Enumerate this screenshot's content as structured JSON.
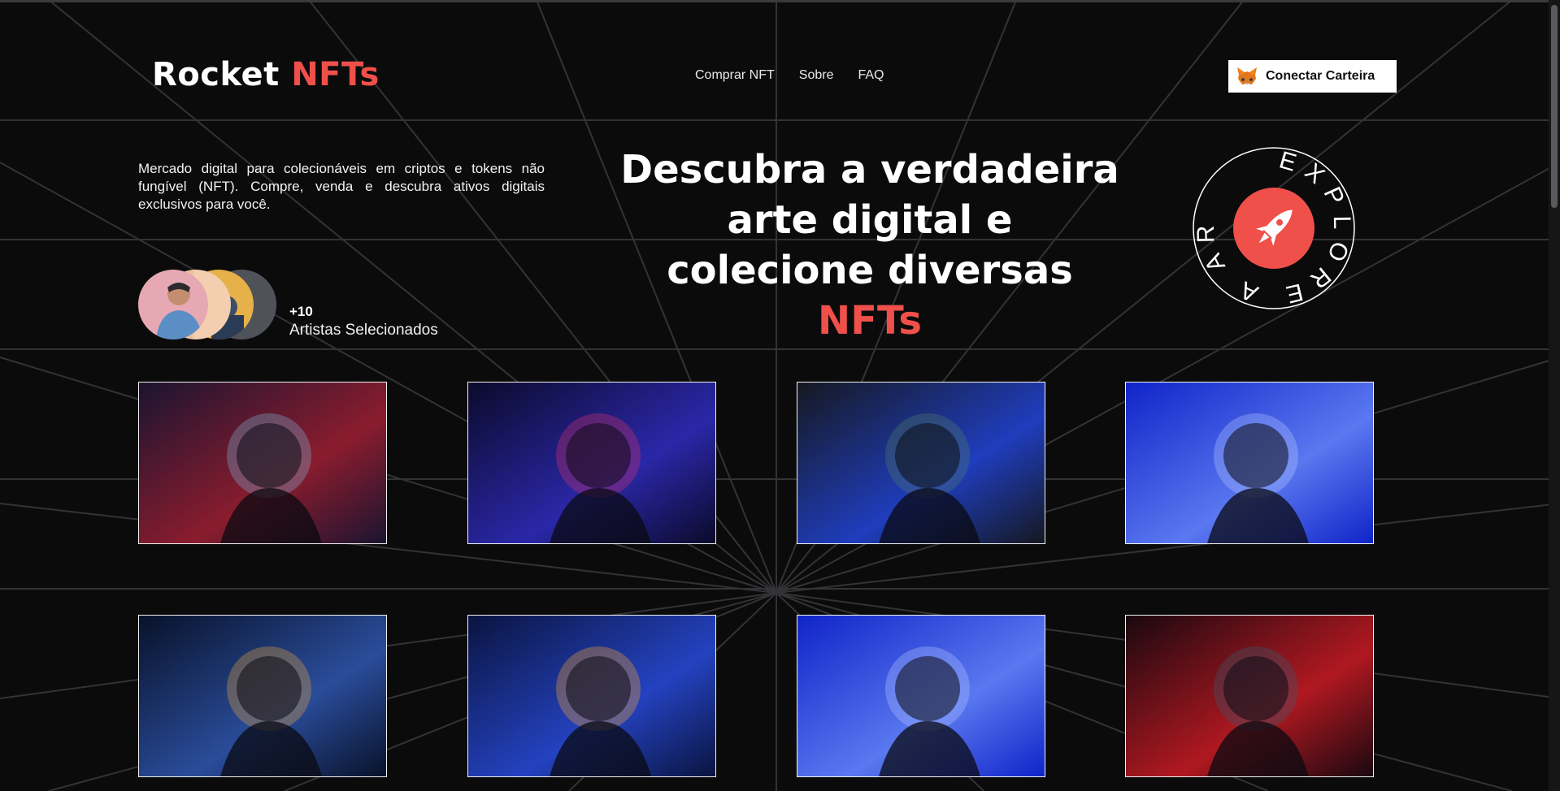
{
  "brand": {
    "name": "Rocket ",
    "accent": "NFTs",
    "accent_color": "#f0504a"
  },
  "nav": {
    "items": [
      "Comprar NFT",
      "Sobre",
      "FAQ"
    ]
  },
  "wallet": {
    "label": "Conectar Carteira",
    "icon": "metamask-fox-icon"
  },
  "intro": {
    "text": "Mercado digital para colecionáveis em criptos e tokens não fungível (NFT). Compre, venda e descubra ativos digitais exclusivos para você."
  },
  "hero": {
    "line1": "Descubra a verdadeira",
    "line2": "arte digital e",
    "line3": "colecione diversas",
    "accent": "NFTs"
  },
  "artists": {
    "count": "+10",
    "label": "Artistas Selecionados"
  },
  "badge": {
    "circle_text": "EXPLORE A ARTE",
    "icon": "rocket-icon"
  },
  "gallery": {
    "items": [
      {
        "name": "nft-card-1",
        "palette": [
          "#1b1430",
          "#8a1c2e",
          "#7fb0d0"
        ]
      },
      {
        "name": "nft-card-2",
        "palette": [
          "#0b0a2a",
          "#2a27a8",
          "#d0306a"
        ]
      },
      {
        "name": "nft-card-3",
        "palette": [
          "#151820",
          "#1f3dbd",
          "#4f7a6a"
        ]
      },
      {
        "name": "nft-card-4",
        "palette": [
          "#1024c8",
          "#5a78f0",
          "#b0c4ff"
        ]
      },
      {
        "name": "nft-card-5",
        "palette": [
          "#08122a",
          "#2a4c9a",
          "#e0a040"
        ]
      },
      {
        "name": "nft-card-6",
        "palette": [
          "#0a1440",
          "#2442c0",
          "#f0a030"
        ]
      },
      {
        "name": "nft-card-7",
        "palette": [
          "#1024c8",
          "#5a78f0",
          "#b0c4ff"
        ]
      },
      {
        "name": "nft-card-8",
        "palette": [
          "#1a0810",
          "#b01820",
          "#3a5a70"
        ]
      }
    ]
  }
}
